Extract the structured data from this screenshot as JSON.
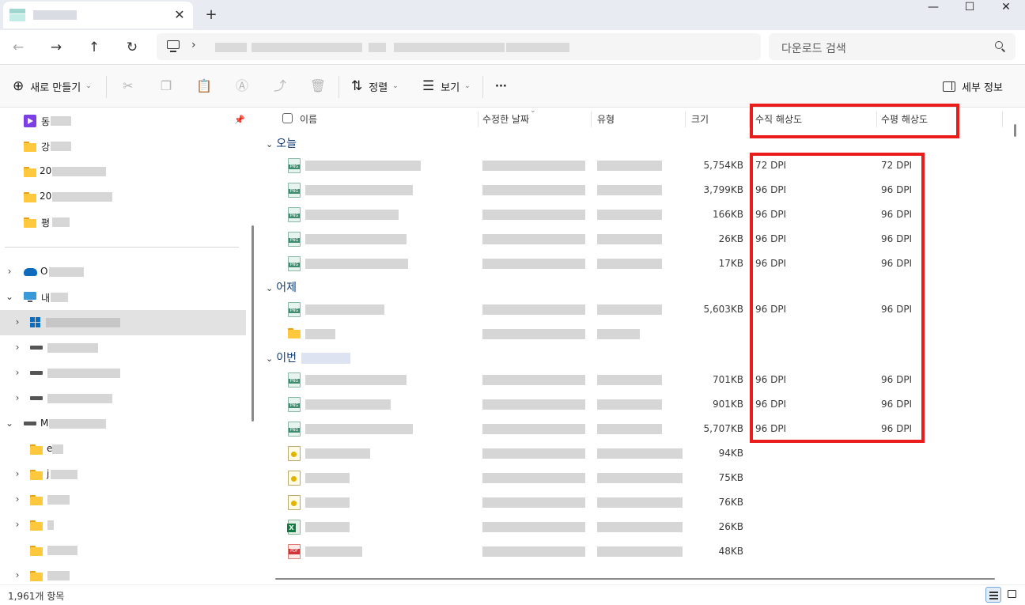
{
  "tab": {
    "close_glyph": "✕",
    "new_glyph": "+"
  },
  "window": {
    "minimize": "—",
    "maximize": "☐",
    "close": "✕"
  },
  "nav": {
    "back": "←",
    "forward": "→",
    "up": "↑",
    "refresh": "↻",
    "chevron": "›"
  },
  "search": {
    "placeholder": "다운로드 검색"
  },
  "toolbar": {
    "new_label": "새로 만들기",
    "sort_label": "정렬",
    "view_label": "보기",
    "more_label": "···",
    "details_label": "세부 정보"
  },
  "columns": {
    "name": "이름",
    "modified": "수정한 날짜",
    "type": "유형",
    "size": "크기",
    "vertical_res": "수직 해상도",
    "horizontal_res": "수평 해상도"
  },
  "groups": {
    "today": "오늘",
    "yesterday": "어제",
    "this_period": "이번"
  },
  "sidebar": {
    "quick_access": [
      {
        "label": "동",
        "icon": "video-folder-icon"
      },
      {
        "label": "강",
        "icon": "folder-icon"
      },
      {
        "label": "20",
        "icon": "folder-icon"
      },
      {
        "label": "20",
        "icon": "folder-icon"
      },
      {
        "label": "평",
        "icon": "folder-icon"
      }
    ],
    "onedrive": "O",
    "this_pc": "내",
    "drive_m": "M",
    "subfolders": [
      "e",
      "j",
      "",
      "",
      "'",
      "-"
    ]
  },
  "files": [
    {
      "group": "today",
      "icon": "png",
      "size": "5,754KB",
      "vres": "72 DPI",
      "hres": "72 DPI"
    },
    {
      "group": "today",
      "icon": "png",
      "size": "3,799KB",
      "vres": "96 DPI",
      "hres": "96 DPI"
    },
    {
      "group": "today",
      "icon": "png",
      "size": "166KB",
      "vres": "96 DPI",
      "hres": "96 DPI"
    },
    {
      "group": "today",
      "icon": "png",
      "size": "26KB",
      "vres": "96 DPI",
      "hres": "96 DPI"
    },
    {
      "group": "today",
      "icon": "png",
      "size": "17KB",
      "vres": "96 DPI",
      "hres": "96 DPI"
    },
    {
      "group": "yesterday",
      "icon": "png",
      "size": "5,603KB",
      "vres": "96 DPI",
      "hres": "96 DPI"
    },
    {
      "group": "yesterday",
      "icon": "folder",
      "size": "",
      "vres": "",
      "hres": ""
    },
    {
      "group": "this_period",
      "icon": "png",
      "size": "701KB",
      "vres": "96 DPI",
      "hres": "96 DPI"
    },
    {
      "group": "this_period",
      "icon": "png",
      "size": "901KB",
      "vres": "96 DPI",
      "hres": "96 DPI"
    },
    {
      "group": "this_period",
      "icon": "png",
      "size": "5,707KB",
      "vres": "96 DPI",
      "hres": "96 DPI"
    },
    {
      "group": "this_period",
      "icon": "generic",
      "size": "94KB",
      "vres": "",
      "hres": ""
    },
    {
      "group": "this_period",
      "icon": "generic",
      "size": "75KB",
      "vres": "",
      "hres": ""
    },
    {
      "group": "this_period",
      "icon": "generic",
      "size": "76KB",
      "vres": "",
      "hres": ""
    },
    {
      "group": "this_period",
      "icon": "excel",
      "size": "26KB",
      "vres": "",
      "hres": ""
    },
    {
      "group": "this_period",
      "icon": "pdf",
      "size": "48KB",
      "vres": "",
      "hres": ""
    }
  ],
  "status": {
    "item_count": "1,961개 항목"
  },
  "colors": {
    "highlight": "#ea1c1c",
    "selection": "#e2e2e2",
    "group_header": "#0f3b73"
  }
}
